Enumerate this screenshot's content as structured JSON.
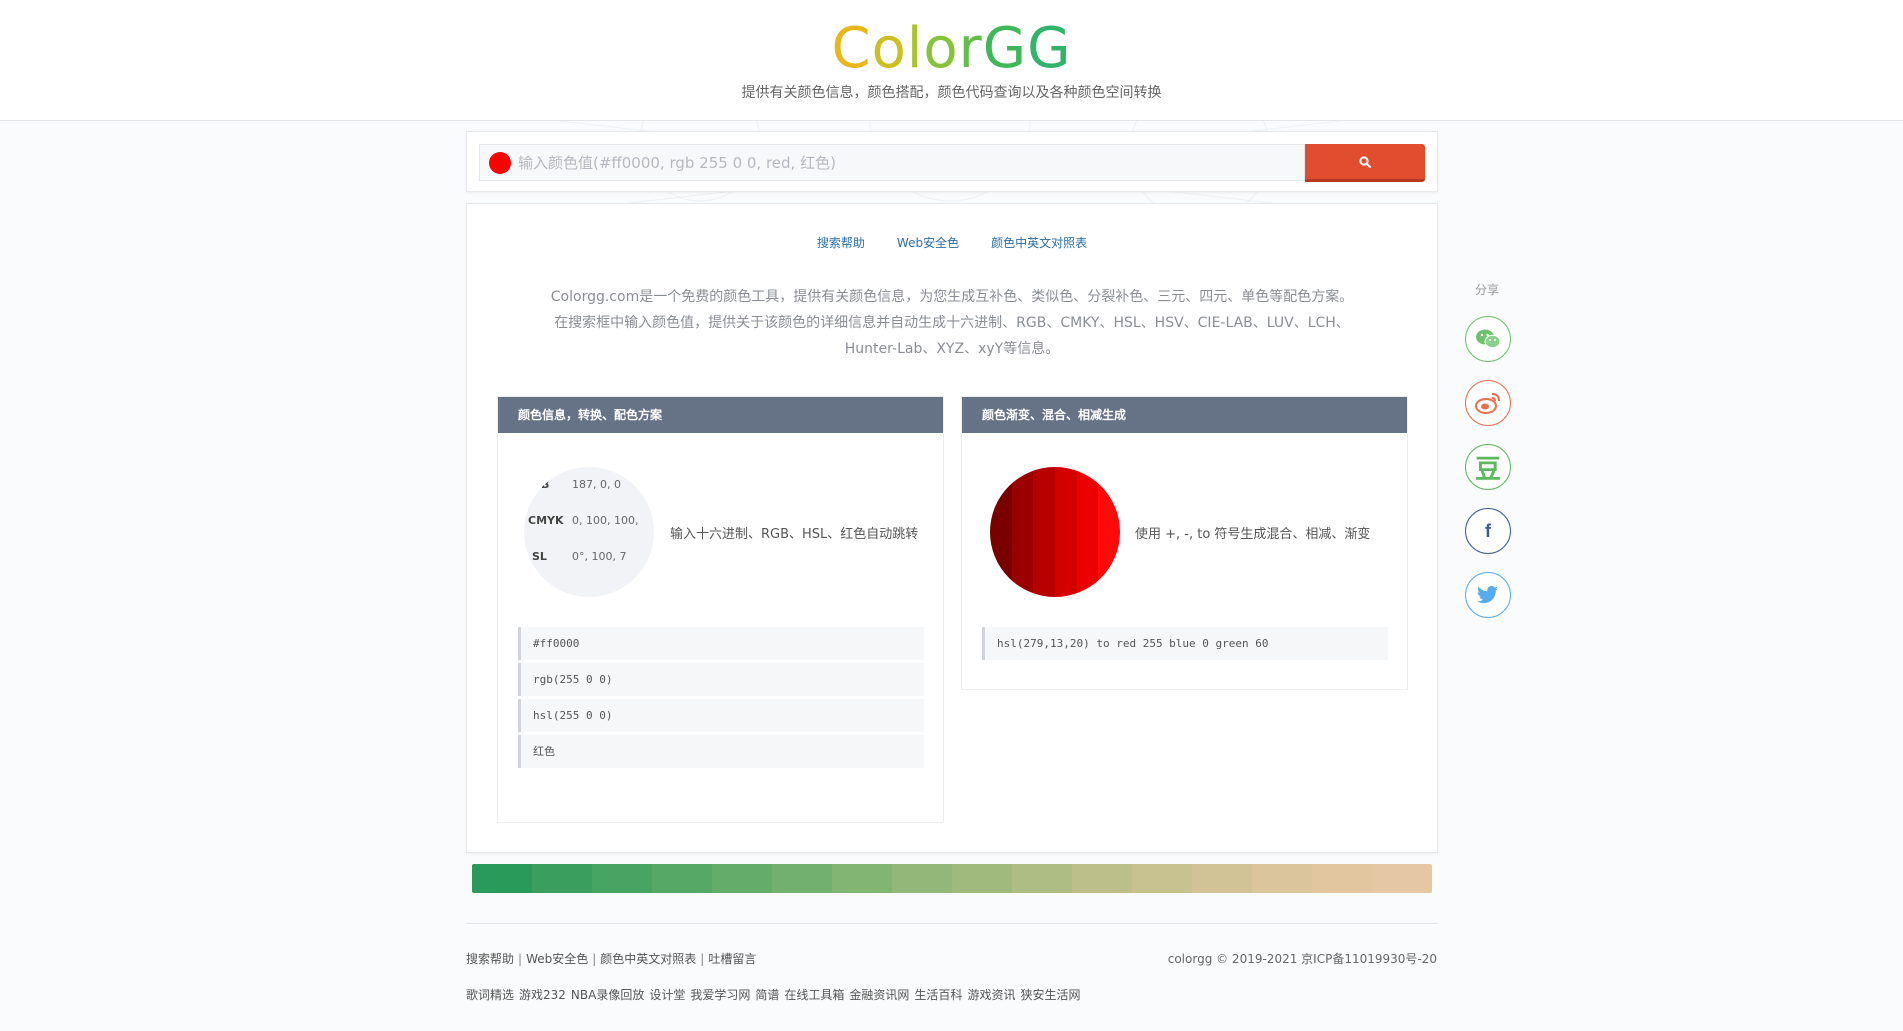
{
  "header": {
    "logo": [
      "C",
      "o",
      "l",
      "o",
      "r",
      "G",
      "G"
    ],
    "subtitle": "提供有关颜色信息，颜色搭配，颜色代码查询以及各种颜色空间转换"
  },
  "search": {
    "placeholder": "输入颜色值(#ff0000, rgb 255 0 0, red, 红色)",
    "swatch_color": "#ff0000",
    "button_icon": "search-icon"
  },
  "nav": {
    "help": "搜索帮助",
    "websafe": "Web安全色",
    "names": "颜色中英文对照表"
  },
  "intro": {
    "line1": "Colorgg.com是一个免费的颜色工具，提供有关颜色信息，为您生成互补色、类似色、分裂补色、三元、四元、单色等配色方案。",
    "line2": "在搜索框中输入颜色值，提供关于该颜色的详细信息并自动生成十六进制、RGB、CMKY、HSL、HSV、CIE-LAB、LUV、LCH、",
    "line3": "Hunter-Lab、XYZ、xyY等信息。"
  },
  "left_panel": {
    "title": "颜色信息，转换、配色方案",
    "info": {
      "rgb_key": "GB",
      "rgb_val": "187, 0, 0",
      "cmyk_key": "CMYK",
      "cmyk_val": "0, 100, 100,",
      "hsl_key": "SL",
      "hsl_val": "0°, 100, 7"
    },
    "desc": "输入十六进制、RGB、HSL、红色自动跳转",
    "examples": [
      "#ff0000",
      "rgb(255 0 0)",
      "hsl(255 0 0)",
      "红色"
    ]
  },
  "right_panel": {
    "title": "颜色渐变、混合、相减生成",
    "gradient": [
      "#7a0000",
      "#9a0000",
      "#b80000",
      "#d40000",
      "#ec0000",
      "#ff0a0a"
    ],
    "desc": "使用 +, -, to 符号生成混合、相减、渐变",
    "example": "hsl(279,13,20) to red 255 blue 0 green 60"
  },
  "bar_colors": [
    "#2a9a5a",
    "#3a9f5e",
    "#47a462",
    "#55a866",
    "#63ac6a",
    "#72b06f",
    "#82b474",
    "#91b779",
    "#a0ba7e",
    "#aebd84",
    "#bcbf8a",
    "#c8c190",
    "#d2c396",
    "#dbc59c",
    "#e1c6a0",
    "#e6c7a4"
  ],
  "share": {
    "label": "分享",
    "buttons": [
      {
        "icon": "wechat-icon",
        "color": "#6dc16d"
      },
      {
        "icon": "weibo-icon",
        "color": "#e8704c"
      },
      {
        "icon": "douban-icon",
        "color": "#5cb85c"
      },
      {
        "icon": "facebook-icon",
        "color": "#3b5998"
      },
      {
        "icon": "twitter-icon",
        "color": "#55acee"
      }
    ]
  },
  "footer": {
    "links": [
      "搜索帮助",
      "Web安全色",
      "颜色中英文对照表",
      "吐槽留言"
    ],
    "separator": "|",
    "copyright": "colorgg © 2019-2021 京ICP备11019930号-20",
    "friend_links": [
      "歌词精选",
      "游戏232",
      "NBA录像回放",
      "设计堂",
      "我爱学习网",
      "简谱",
      "在线工具箱",
      "金融资讯网",
      "生活百科",
      "游戏资讯",
      "狭安生活网"
    ]
  }
}
